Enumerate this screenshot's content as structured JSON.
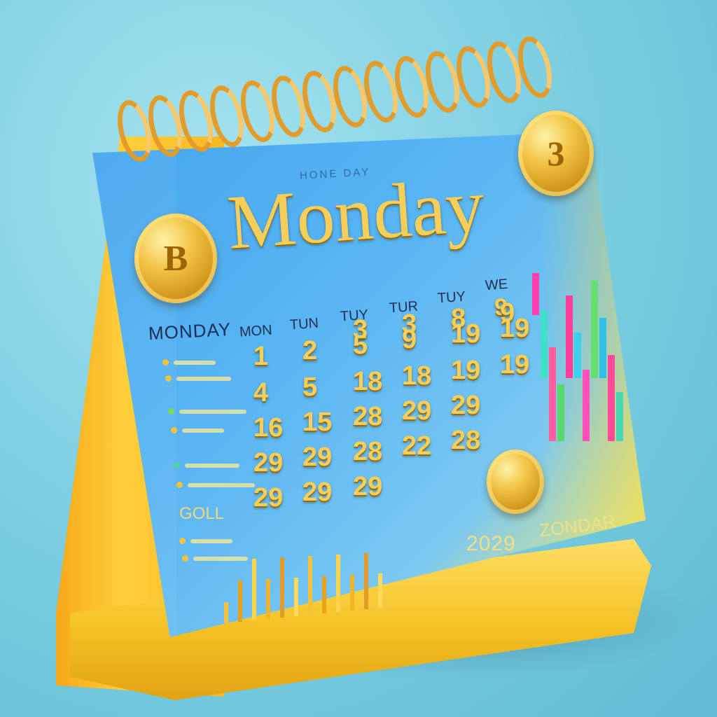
{
  "header": {
    "small_title": "HONE DAY",
    "main_title": "Monday"
  },
  "weekdays": [
    "MON",
    "TUN",
    "TUY",
    "TUR",
    "TUY",
    "WE"
  ],
  "weekday_extra": "9",
  "grid_numbers": {
    "row0": [
      "",
      "",
      "3",
      "3",
      "8",
      "9"
    ],
    "row1": [
      "1",
      "2",
      "5",
      "9",
      "19",
      "19"
    ],
    "row2": [
      "4",
      "5",
      "18",
      "18",
      "19",
      "19"
    ],
    "row3": [
      "16",
      "15",
      "28",
      "29",
      "29",
      ""
    ],
    "row4": [
      "29",
      "29",
      "28",
      "22",
      "28",
      ""
    ],
    "row5": [
      "29",
      "29",
      "29",
      "",
      "",
      ""
    ]
  },
  "side_panel": {
    "heading": "MONDAY",
    "sub_heading": "GOLL"
  },
  "footer": {
    "year": "2029",
    "label": "ZONDAR"
  },
  "coins": {
    "left": "B",
    "right": "3"
  },
  "colors": {
    "page": "#4aa8ee",
    "gold": "#f6cf5a",
    "stand": "#f7b21f",
    "ring": "#e39b29"
  }
}
